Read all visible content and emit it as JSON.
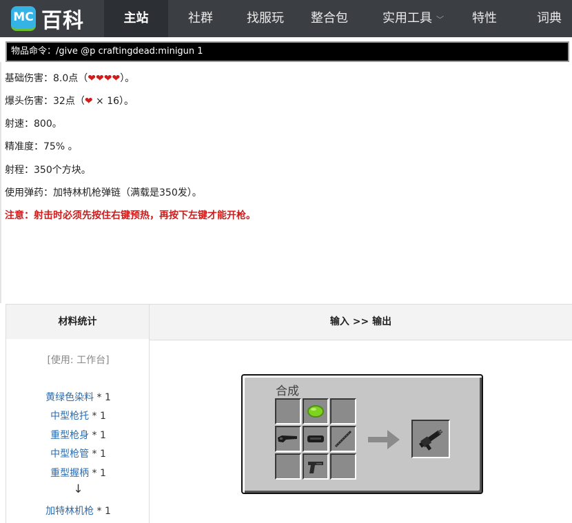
{
  "nav": {
    "logo_mc": "MC",
    "logo_text": "百科",
    "items": [
      {
        "label": "主站",
        "active": true
      },
      {
        "label": "社群"
      },
      {
        "label": "找服玩"
      },
      {
        "label": "整合包"
      },
      {
        "label": "实用工具",
        "dropdown": true
      },
      {
        "label": "特性"
      },
      {
        "label": "词典"
      }
    ]
  },
  "item": {
    "command": "物品命令：/give @p craftingdead:minigun 1",
    "base_damage_prefix": "基础伤害：8.0点（",
    "base_damage_hearts": "❤❤❤❤",
    "base_damage_suffix": "）。",
    "headshot_prefix": "爆头伤害：32点（",
    "headshot_heart": "❤",
    "headshot_suffix": " × 16）。",
    "fire_rate": "射速：800。",
    "accuracy": "精准度：75% 。",
    "range": "射程：350个方块。",
    "ammo": "使用弹药：加特林机枪弹链（满载是350发）。",
    "warning": "注意：射击时必须先按住右键预热，再按下左键才能开枪。"
  },
  "recipe": {
    "header_materials": "材料统计",
    "header_io": "输入 >> 输出",
    "station": "[使用: 工作台]",
    "materials": [
      {
        "name": "黄绿色染料",
        "qty": " * 1"
      },
      {
        "name": "中型枪托",
        "qty": " * 1"
      },
      {
        "name": "重型枪身",
        "qty": " * 1"
      },
      {
        "name": "中型枪管",
        "qty": " * 1"
      },
      {
        "name": "重型握柄",
        "qty": " * 1"
      }
    ],
    "down_arrow": "↓",
    "result_name": "加特林机枪",
    "result_qty": " * 1",
    "gui_title": "合成"
  },
  "colors": {
    "nav_bg": "#3b3f44",
    "link": "#2b6cb0",
    "warning": "#d01b1b",
    "heart": "#d01b1b",
    "gui_bg": "#c6c6c6",
    "slot": "#8b8b8b"
  }
}
